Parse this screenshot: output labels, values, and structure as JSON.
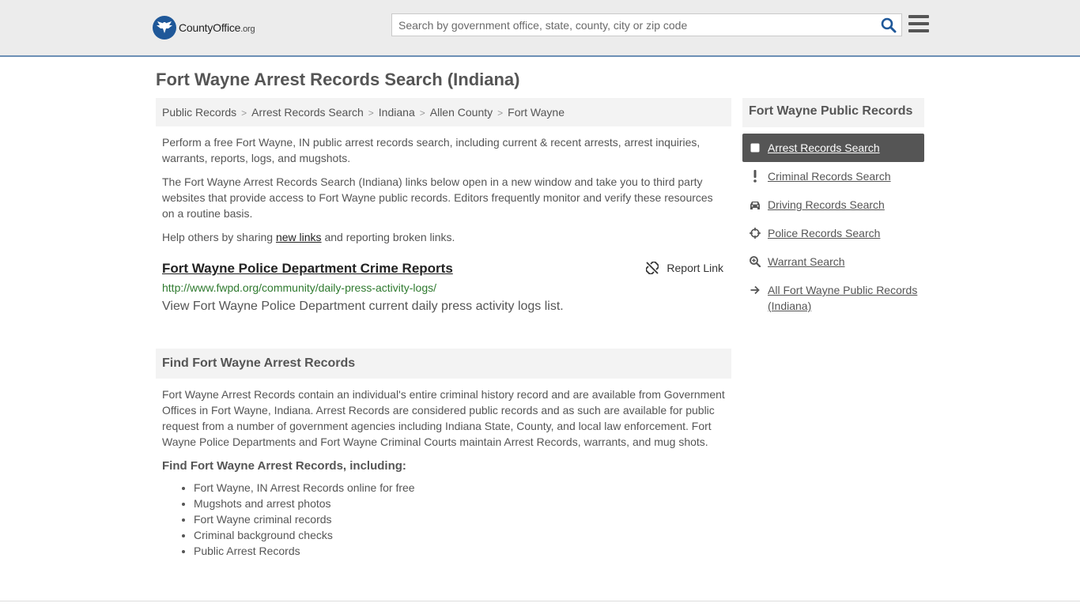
{
  "header": {
    "logo_text": "CountyOffice",
    "logo_suffix": ".org",
    "search_placeholder": "Search by government office, state, county, city or zip code",
    "search_value": ""
  },
  "page_title": "Fort Wayne Arrest Records Search (Indiana)",
  "breadcrumb": [
    {
      "label": "Public Records"
    },
    {
      "label": "Arrest Records Search"
    },
    {
      "label": "Indiana"
    },
    {
      "label": "Allen County"
    },
    {
      "label": "Fort Wayne"
    }
  ],
  "intro": {
    "p1": "Perform a free Fort Wayne, IN public arrest records search, including current & recent arrests, arrest inquiries, warrants, reports, logs, and mugshots.",
    "p2": "The Fort Wayne Arrest Records Search (Indiana) links below open in a new window and take you to third party websites that provide access to Fort Wayne public records. Editors frequently monitor and verify these resources on a routine basis.",
    "p3_before": "Help others by sharing ",
    "p3_link": "new links",
    "p3_after": " and reporting broken links."
  },
  "result": {
    "title": "Fort Wayne Police Department Crime Reports",
    "report_label": "Report Link",
    "url": "http://www.fwpd.org/community/daily-press-activity-logs/",
    "description": "View Fort Wayne Police Department current daily press activity logs list."
  },
  "find_section": {
    "heading": "Find Fort Wayne Arrest Records",
    "body": "Fort Wayne Arrest Records contain an individual's entire criminal history record and are available from Government Offices in Fort Wayne, Indiana. Arrest Records are considered public records and as such are available for public request from a number of government agencies including Indiana State, County, and local law enforcement. Fort Wayne Police Departments and Fort Wayne Criminal Courts maintain Arrest Records, warrants, and mug shots.",
    "subheading": "Find Fort Wayne Arrest Records, including:",
    "items": [
      "Fort Wayne, IN Arrest Records online for free",
      "Mugshots and arrest photos",
      "Fort Wayne criminal records",
      "Criminal background checks",
      "Public Arrest Records"
    ]
  },
  "sidebar": {
    "heading": "Fort Wayne Public Records",
    "items": [
      {
        "label": "Arrest Records Search",
        "icon": "square-icon",
        "active": true
      },
      {
        "label": "Criminal Records Search",
        "icon": "exclamation-icon",
        "active": false
      },
      {
        "label": "Driving Records Search",
        "icon": "car-icon",
        "active": false
      },
      {
        "label": "Police Records Search",
        "icon": "crosshairs-icon",
        "active": false
      },
      {
        "label": "Warrant Search",
        "icon": "search-plus-icon",
        "active": false
      },
      {
        "label": "All Fort Wayne Public Records (Indiana)",
        "icon": "arrow-right-icon",
        "active": false
      }
    ]
  },
  "colors": {
    "header_bg": "#ececec",
    "header_border": "#6c8fb5",
    "logo_blue": "#1f5899",
    "url_green": "#2f7a2f",
    "active_bg": "#555555",
    "search_icon": "#1f5899"
  }
}
